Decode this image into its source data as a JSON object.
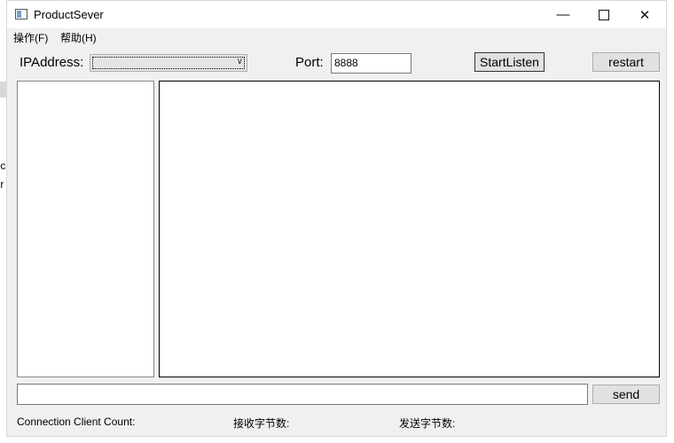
{
  "window": {
    "title": "ProductSever"
  },
  "menu": [
    {
      "label": "操作(F)"
    },
    {
      "label": "帮助(H)"
    }
  ],
  "toolbar": {
    "ip_label": "IPAddress:",
    "ip_value": "",
    "port_label": "Port:",
    "port_value": "8888",
    "start_label": "StartListen",
    "restart_label": "restart"
  },
  "client_list": [],
  "log_text": "",
  "message": {
    "value": "",
    "send_label": "send"
  },
  "status": {
    "connection_label": "Connection Client Count:",
    "received_label": "接收字节数:",
    "sent_label": "发送字节数:"
  },
  "icons": {
    "app": "app-window-icon",
    "minimize": "minimize-icon",
    "maximize": "maximize-icon",
    "close": "close-icon",
    "dropdown": "chevron-down-icon"
  }
}
